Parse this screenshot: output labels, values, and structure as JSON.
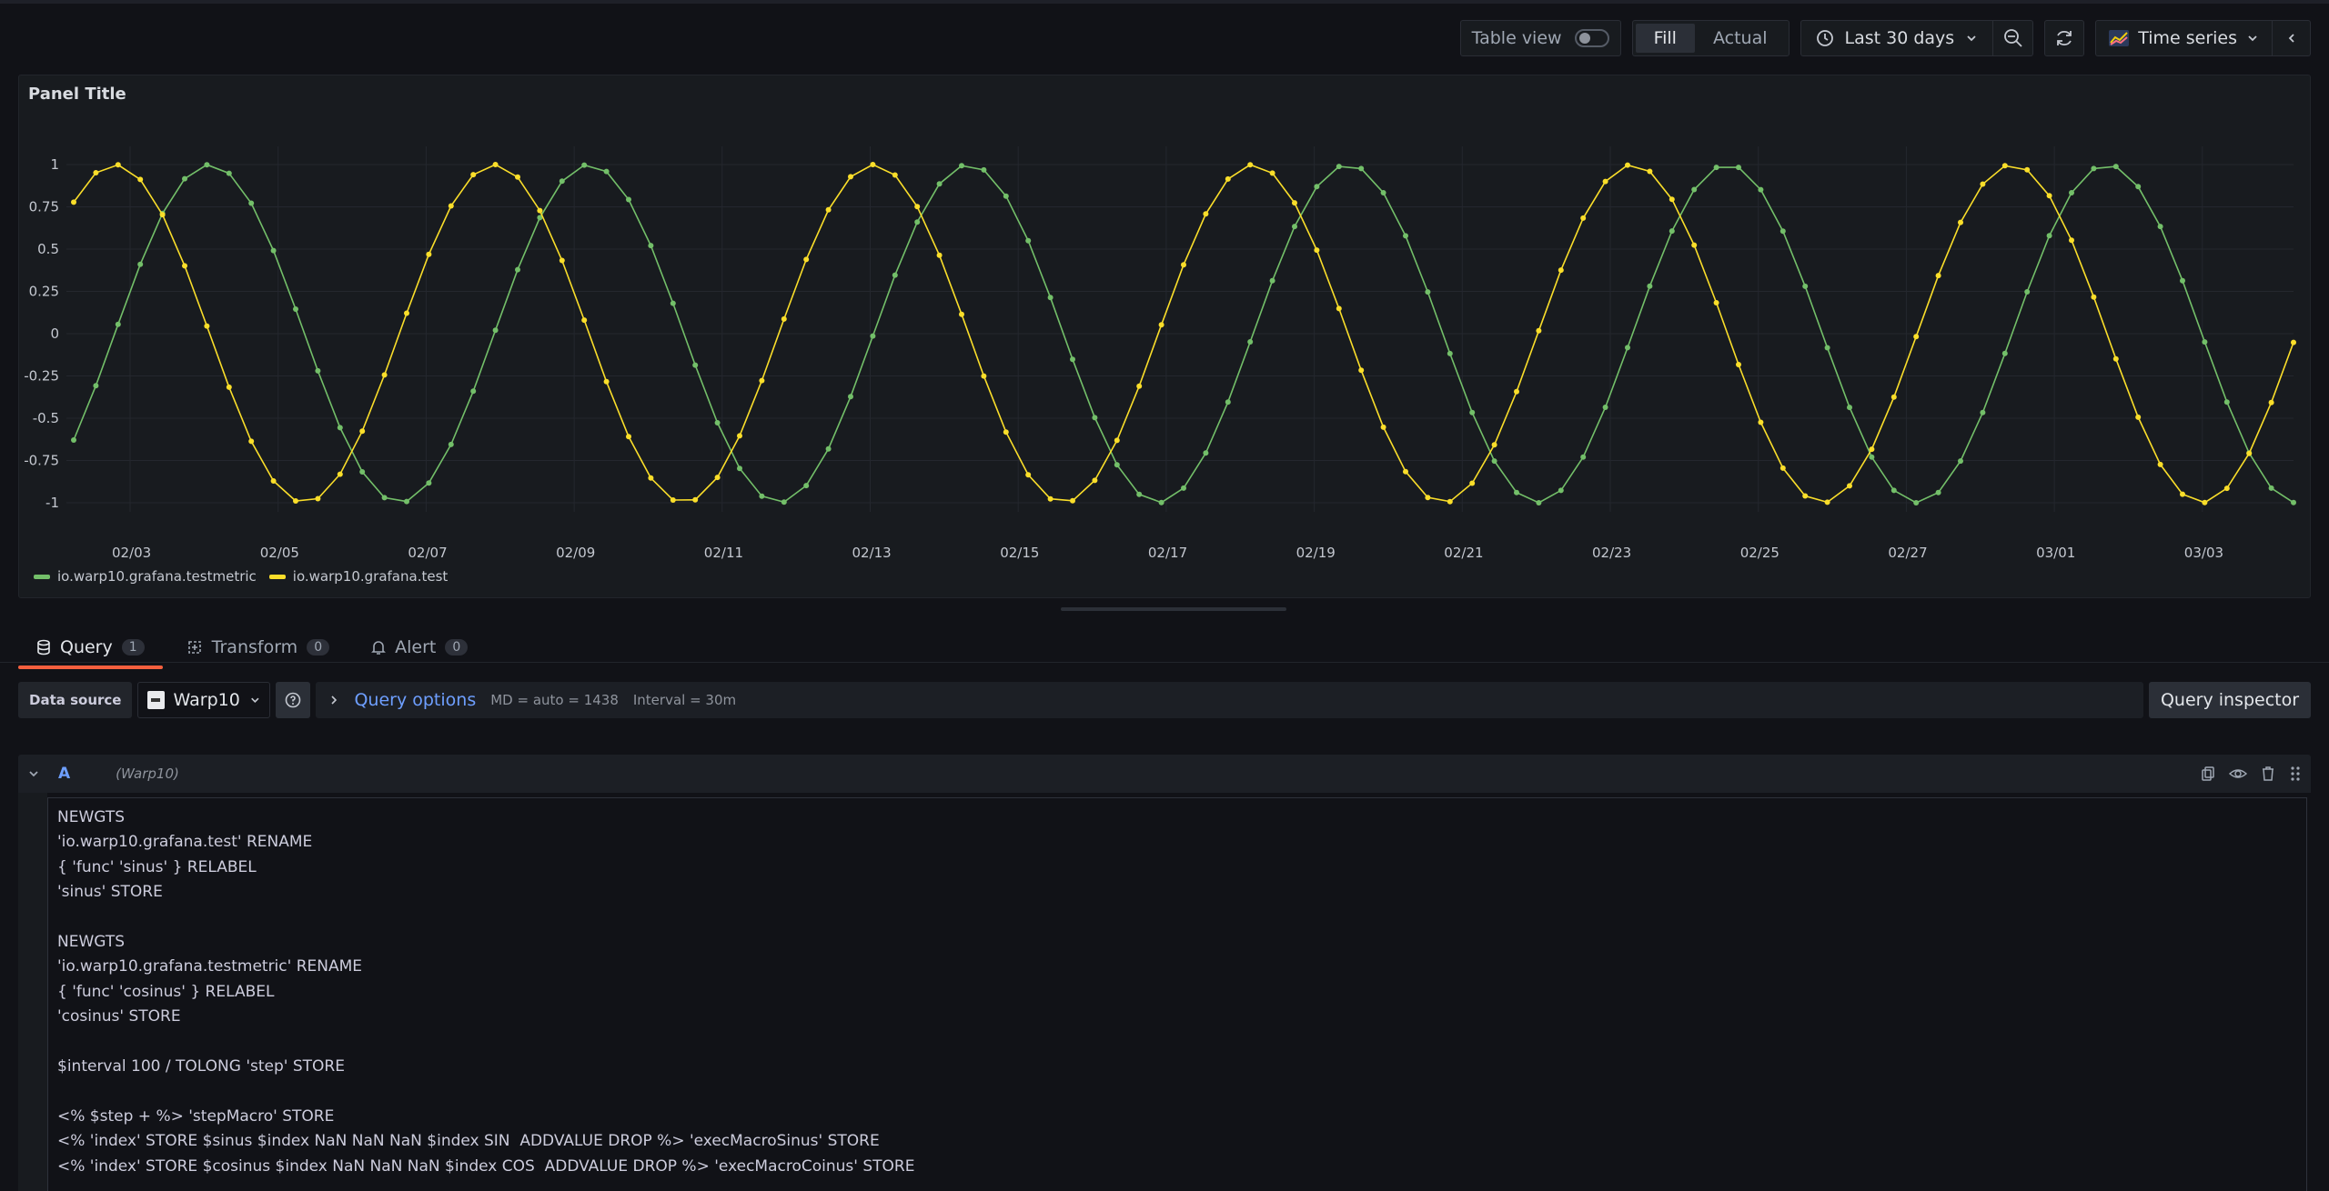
{
  "toolbar": {
    "table_view_label": "Table view",
    "fill_label": "Fill",
    "actual_label": "Actual",
    "time_range": "Last 30 days",
    "viz_type": "Time series"
  },
  "panel": {
    "title": "Panel Title"
  },
  "chart_data": {
    "type": "line",
    "x_tick_labels": [
      "02/03",
      "02/05",
      "02/07",
      "02/09",
      "02/11",
      "02/13",
      "02/15",
      "02/17",
      "02/19",
      "02/21",
      "02/23",
      "02/25",
      "02/27",
      "03/01",
      "03/03"
    ],
    "y_tick_labels": [
      "1",
      "0.75",
      "0.5",
      "0.25",
      "0",
      "-0.25",
      "-0.5",
      "-0.75",
      "-1"
    ],
    "ylim": [
      -1,
      1
    ],
    "grid": true,
    "legend_placement": "bottom-left",
    "series": [
      {
        "name": "io.warp10.grafana.testmetric",
        "color": "#73bf69",
        "function": "sin",
        "points": 101,
        "phase": -0.68
      },
      {
        "name": "io.warp10.grafana.test",
        "color": "#fade2a",
        "function": "cos",
        "points": 101,
        "phase": -0.68
      }
    ],
    "cycles": 5.85
  },
  "tabs": [
    {
      "label": "Query",
      "count": "1"
    },
    {
      "label": "Transform",
      "count": "0"
    },
    {
      "label": "Alert",
      "count": "0"
    }
  ],
  "query_row": {
    "datasource_label": "Data source",
    "datasource": "Warp10",
    "options_label": "Query options",
    "md": "MD = auto = 1438",
    "interval": "Interval = 30m",
    "inspector_label": "Query inspector"
  },
  "query": {
    "ref_id": "A",
    "datasource": "(Warp10)",
    "lines": [
      "NEWGTS",
      "'io.warp10.grafana.test' RENAME",
      "{ 'func' 'sinus' } RELABEL",
      "'sinus' STORE",
      "",
      "NEWGTS",
      "'io.warp10.grafana.testmetric' RENAME",
      "{ 'func' 'cosinus' } RELABEL",
      "'cosinus' STORE",
      "",
      "$interval 100 / TOLONG 'step' STORE",
      "",
      "<% $step + %> 'stepMacro' STORE",
      "<% 'index' STORE $sinus $index NaN NaN NaN $index SIN  ADDVALUE DROP %> 'execMacroSinus' STORE",
      "<% 'index' STORE $cosinus $index NaN NaN NaN $index COS  ADDVALUE DROP %> 'execMacroCoinus' STORE"
    ]
  }
}
